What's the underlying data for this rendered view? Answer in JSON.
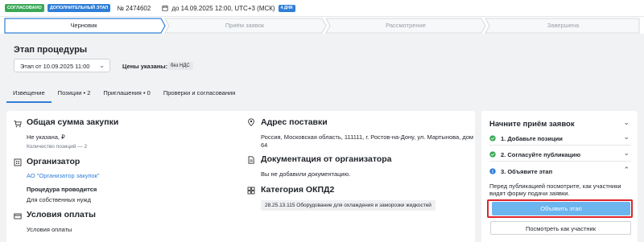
{
  "topbar": {
    "status_badge": "СОГЛАСОВАНО",
    "stage_badge": "ДОПОЛНИТЕЛЬНЫЙ ЭТАП",
    "procedure_number": "№ 2474602",
    "deadline": "до 14.09.2025 12:00, UTC+3 (МСК)",
    "days_badge": "4 ДНЯ",
    "colors": {
      "status": "#3aa957",
      "stage": "#2f7ed8"
    }
  },
  "steps": [
    {
      "label": "Черновик",
      "active": true
    },
    {
      "label": "Приём заявок",
      "active": false
    },
    {
      "label": "Рассмотрение",
      "active": false
    },
    {
      "label": "Завершена",
      "active": false
    }
  ],
  "stage": {
    "title": "Этап процедуры",
    "select_value": "Этап от 10.09.2025 11:00",
    "prices_label": "Цены указаны:",
    "prices_badge": "без НДС"
  },
  "tabs": [
    {
      "label": "Извещение",
      "active": true
    },
    {
      "label": "Позиции • 2",
      "active": false
    },
    {
      "label": "Приглашения • 0",
      "active": false
    },
    {
      "label": "Проверки и согласования",
      "active": false
    }
  ],
  "main": {
    "total": {
      "title": "Общая сумма закупки",
      "value": "Не указана, ₽",
      "positions": "Количество позиций — 2"
    },
    "organizer": {
      "title": "Организатор",
      "name": "АО \"Организатор закупок\"",
      "held_label": "Процедура проводится",
      "held_value": "Для собственных нужд"
    },
    "payment": {
      "title": "Условия оплаты",
      "value": "Условия оплаты"
    },
    "address": {
      "title": "Адрес поставки",
      "line1": "Россия, Московская область, 111111, г. Ростов-на-Дону, ул. Мартынова, дом",
      "line2": "64"
    },
    "docs": {
      "title": "Документация от организатора",
      "value": "Вы не добавили документацию."
    },
    "okpd": {
      "title": "Категория ОКПД2",
      "chip": "28.25.13.115 Оборудование для охлаждения и заморозки жидкостей"
    }
  },
  "side": {
    "title": "Начните приём заявок",
    "steps": [
      {
        "label": "1. Добавьте позиции",
        "status": "done"
      },
      {
        "label": "2. Согласуйте публикацию",
        "status": "done"
      },
      {
        "label": "3. Объявите этап",
        "status": "info"
      }
    ],
    "hint_line1": "Перед публикацией посмотрите, как участники",
    "hint_line2": "видят форму подачи заявки.",
    "primary_button": "Объявить этап",
    "secondary_button": "Посмотреть как участник"
  }
}
